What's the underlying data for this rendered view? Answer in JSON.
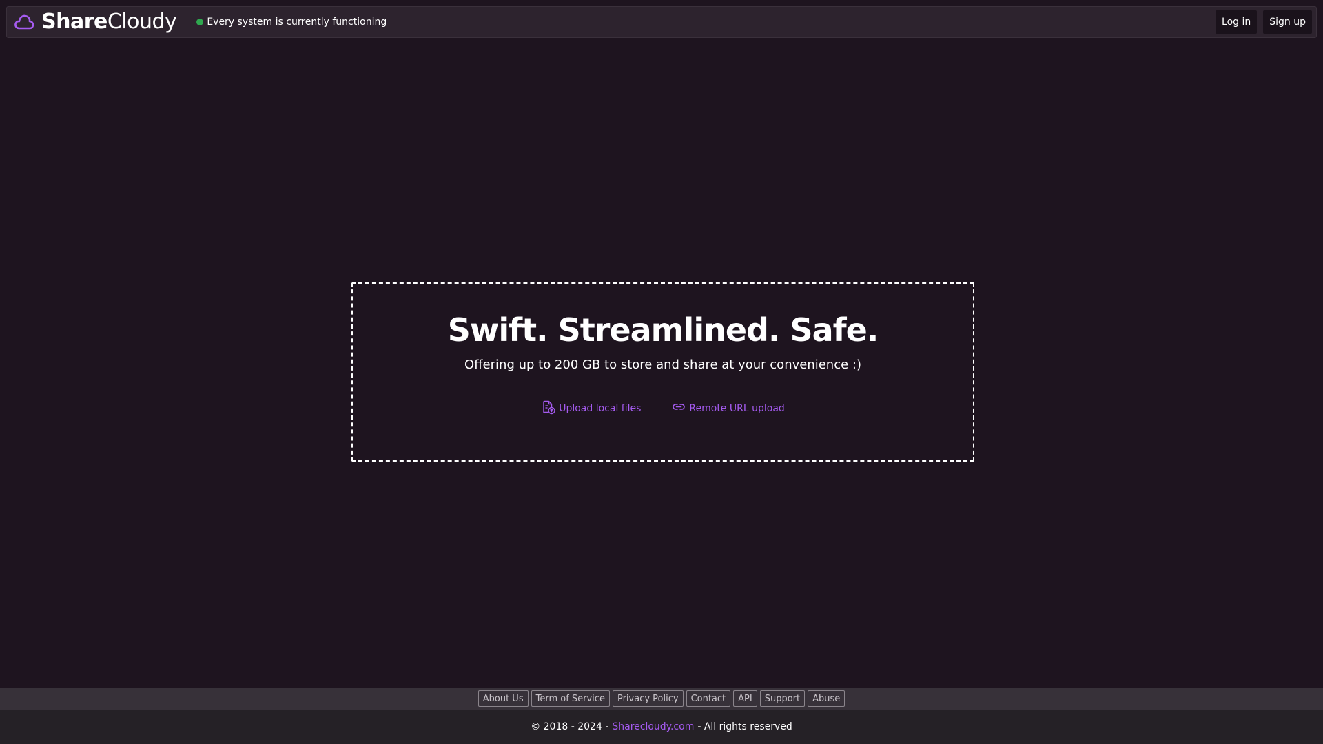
{
  "header": {
    "brand_part1": "Share",
    "brand_part2": "Cloudy",
    "status_text": "Every system is currently functioning",
    "status_color": "#2fa84f",
    "login_label": "Log in",
    "signup_label": "Sign up"
  },
  "hero": {
    "title": "Swift. Streamlined. Safe.",
    "subtitle": "Offering up to 200 GB to store and share at your convenience :)",
    "upload_local_label": "Upload local files",
    "upload_local_icon": "file-upload-icon",
    "remote_url_label": "Remote URL upload",
    "remote_url_icon": "link-icon"
  },
  "footer": {
    "links": [
      "About Us",
      "Term of Service",
      "Privacy Policy",
      "Contact",
      "API",
      "Support",
      "Abuse"
    ],
    "copyright_prefix": "© 2018 - 2024 -",
    "site_link": "Sharecloudy.com",
    "copyright_suffix": "- All rights reserved"
  },
  "colors": {
    "background": "#1e141f",
    "accent": "#a55bf0",
    "navbar": "#2d232e"
  }
}
